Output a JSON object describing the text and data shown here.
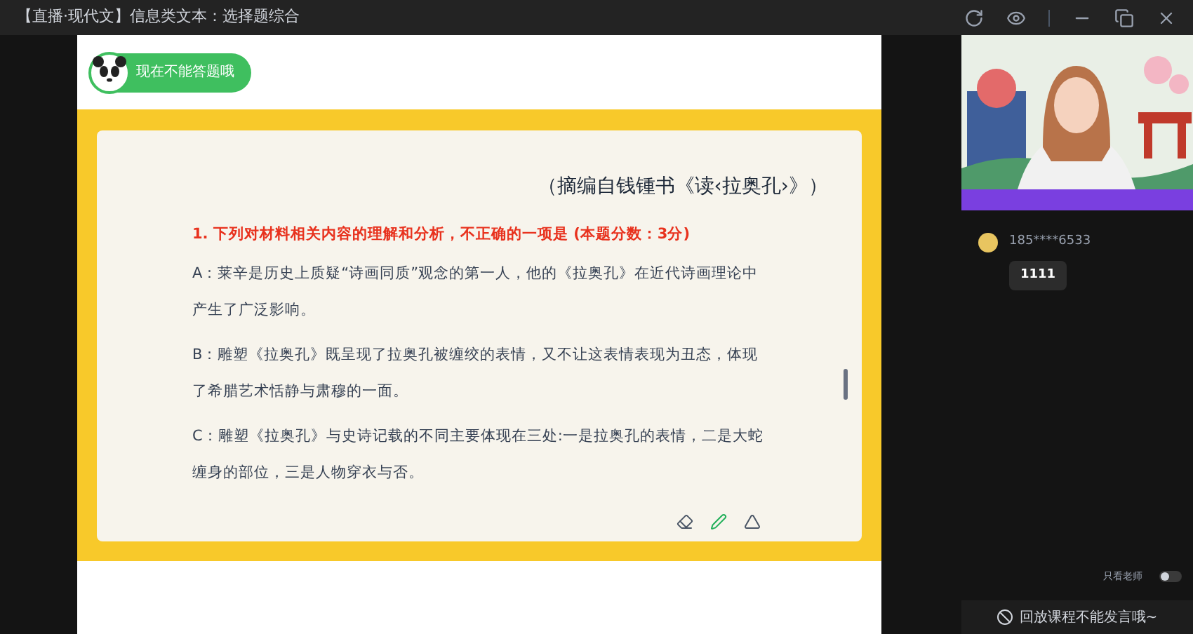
{
  "window": {
    "title": "【直播·现代文】信息类文本：选择题综合"
  },
  "badge": {
    "label": "现在不能答题哦"
  },
  "slide": {
    "source": "（摘编自钱锺书《读‹拉奥孔›》）",
    "question": "1. 下列对材料相关内容的理解和分析，不正确的一项是 (本题分数：3分)",
    "options": [
      {
        "text": "A：莱辛是历史上质疑“诗画同质”观念的第一人，他的《拉奥孔》在近代诗画理论中产生了广泛影响。"
      },
      {
        "text": "B：雕塑《拉奥孔》既呈现了拉奥孔被缠绞的表情，又不让这表情表现为丑态，体现了希腊艺术恬静与肃穆的一面。"
      },
      {
        "text": "C：雕塑《拉奥孔》与史诗记载的不同主要体现在三处:一是拉奥孔的表情，二是大蛇缠身的部位，三是人物穿衣与否。"
      }
    ],
    "tools": [
      {
        "kind": "eraser",
        "selected": false
      },
      {
        "kind": "pen",
        "selected": true
      },
      {
        "kind": "pointer",
        "selected": false
      }
    ]
  },
  "chat": [
    {
      "user": "185****6533",
      "message": "1111"
    }
  ],
  "teacher_only": {
    "label": "只看老师",
    "on": false
  },
  "footer": {
    "notice": "回放课程不能发言哦~"
  }
}
